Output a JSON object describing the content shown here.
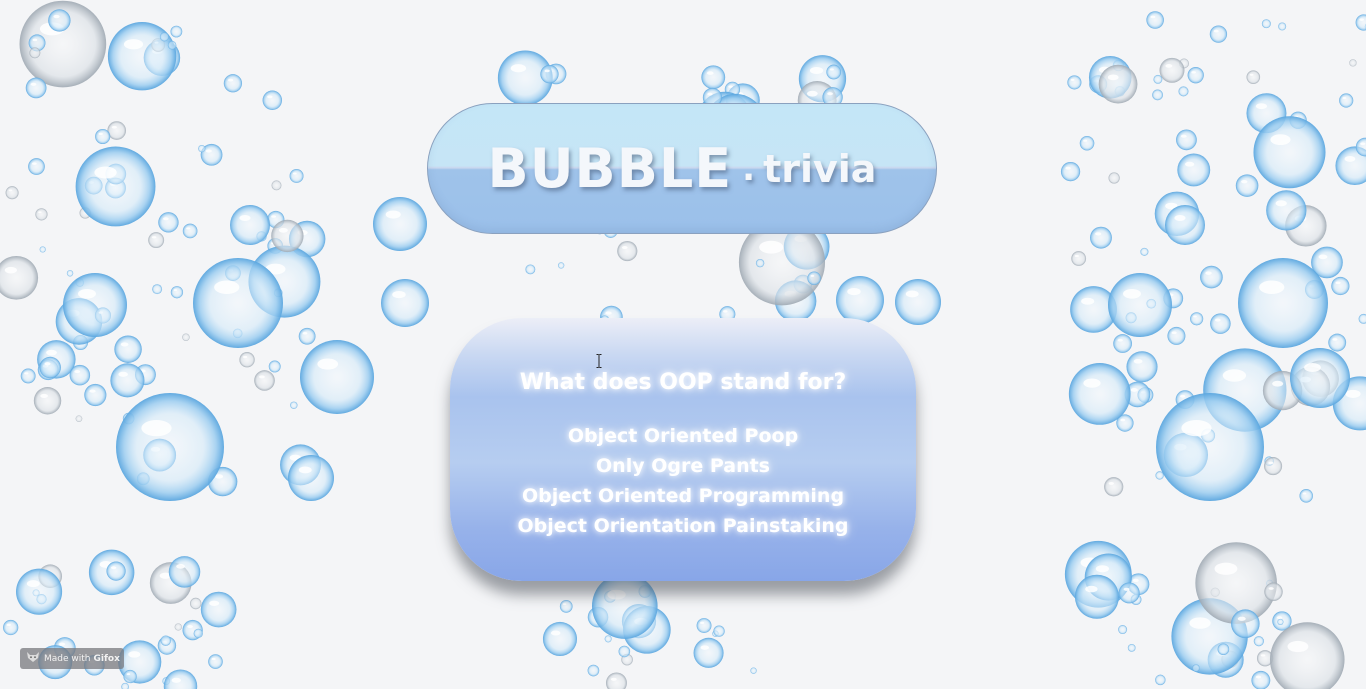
{
  "header": {
    "title_main": "BUBBLE",
    "title_dot": ".",
    "title_sub": "trivia"
  },
  "quiz": {
    "question": "What does OOP stand for?",
    "answers": [
      "Object Oriented Poop",
      "Only Ogre Pants",
      "Object Oriented Programming",
      "Object Orientation Painstaking"
    ]
  },
  "watermark": {
    "prefix": "Made with",
    "brand": "Gifox",
    "icon": "fox-icon"
  },
  "background": {
    "icon": "bubble-icon",
    "colors": {
      "page": "#f4f5f7",
      "bubble_edge": "#6fb2e4",
      "bubble_core": "#e6f3fc"
    }
  }
}
